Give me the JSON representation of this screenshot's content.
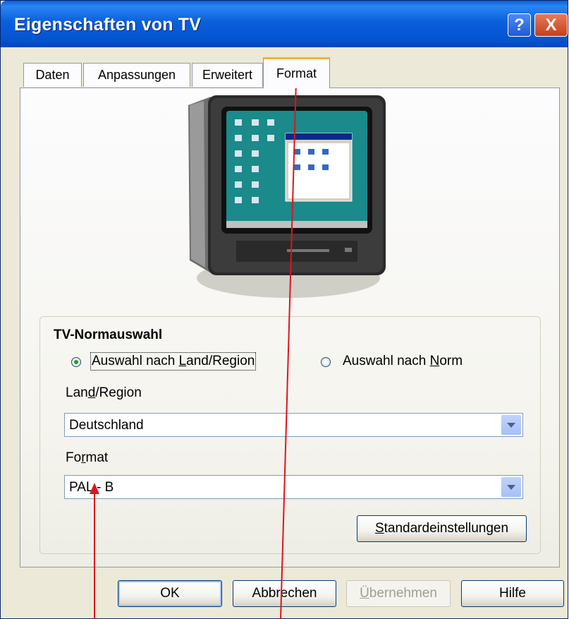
{
  "window": {
    "title": "Eigenschaften von TV",
    "help_button": "?",
    "close_button": "X"
  },
  "tabs": [
    {
      "label": "Daten"
    },
    {
      "label": "Anpassungen"
    },
    {
      "label": "Erweitert"
    },
    {
      "label": "Format",
      "active": true
    }
  ],
  "tv_image": {
    "icon": "tv-monitor-image"
  },
  "norm_group": {
    "title": "TV-Normauswahl",
    "radio_region": {
      "pre": "Auswahl nach ",
      "u": "L",
      "post": "and/Region",
      "checked": true
    },
    "radio_norm": {
      "pre": "Auswahl nach ",
      "u": "N",
      "post": "orm",
      "checked": false
    },
    "region_label": {
      "pre": "Lan",
      "u": "d",
      "post": "/Region"
    },
    "region_value": "Deutschland",
    "format_label": {
      "pre": "Fo",
      "u": "r",
      "post": "mat"
    },
    "format_value": "PAL - B",
    "defaults_button": {
      "u": "S",
      "post": "tandardeinstellungen"
    }
  },
  "footer": {
    "ok": "OK",
    "cancel": "Abbrechen",
    "apply": {
      "u": "Ü",
      "post": "bernehmen"
    },
    "help": "Hilfe"
  },
  "colors": {
    "titlebar": "#0453d1",
    "annotation": "#e0141b",
    "active_tab_accent": "#f0b33a"
  }
}
